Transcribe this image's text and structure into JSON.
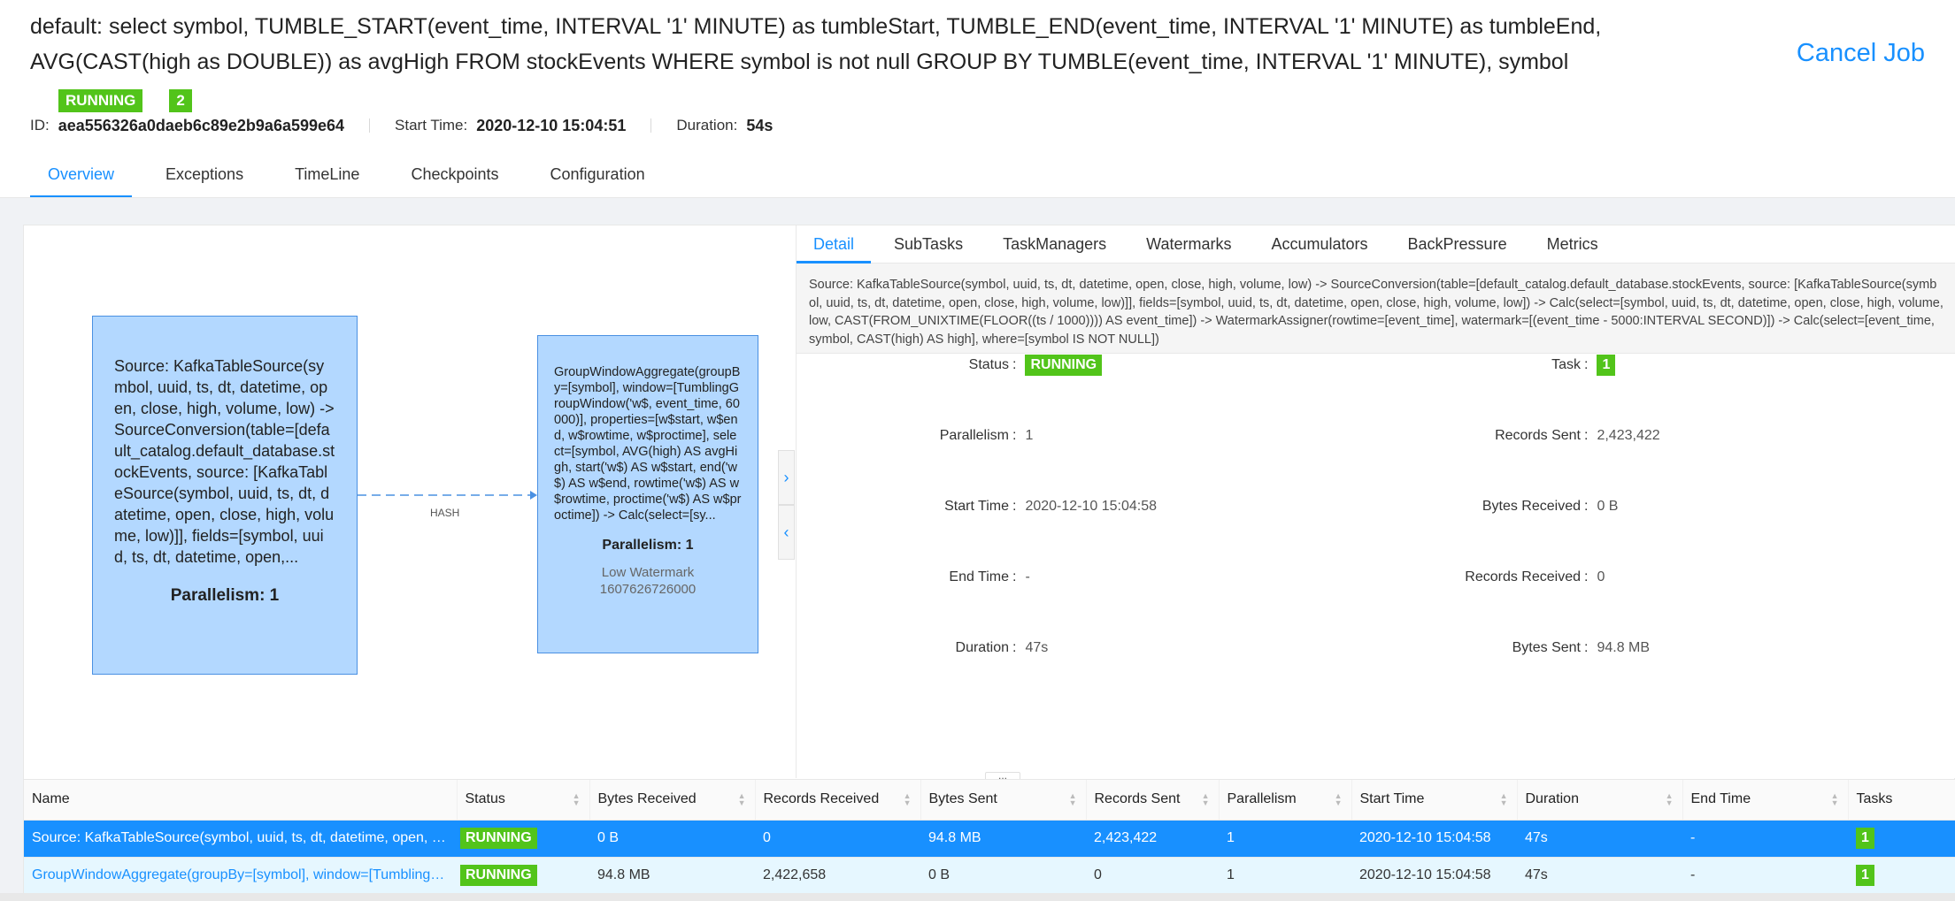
{
  "job": {
    "title": "default: select symbol, TUMBLE_START(event_time, INTERVAL '1' MINUTE) as tumbleStart, TUMBLE_END(event_time, INTERVAL '1' MINUTE) as tumbleEnd, AVG(CAST(high as DOUBLE)) as avgHigh FROM stockEvents WHERE symbol is not null GROUP BY TUMBLE(event_time, INTERVAL '1' MINUTE), symbol",
    "cancel_label": "Cancel Job",
    "status": "RUNNING",
    "running_count": "2",
    "id_label": "ID:",
    "id": "aea556326a0daeb6c89e2b9a6a599e64",
    "start_label": "Start Time:",
    "start_time": "2020-12-10 15:04:51",
    "duration_label": "Duration:",
    "duration": "54s"
  },
  "tabs": [
    "Overview",
    "Exceptions",
    "TimeLine",
    "Checkpoints",
    "Configuration"
  ],
  "graph": {
    "node1": {
      "text": "Source: KafkaTableSource(symbol, uuid, ts, dt, datetime, open, close, high, volume, low) -> SourceConversion(table=[default_catalog.default_database.stockEvents, source: [KafkaTableSource(symbol, uuid, ts, dt, datetime, open, close, high, volume, low)]], fields=[symbol, uuid, ts, dt, datetime, open,...",
      "parallelism": "Parallelism: 1"
    },
    "node2": {
      "text": "GroupWindowAggregate(groupBy=[symbol], window=[TumblingGroupWindow('w$, event_time, 60000)], properties=[w$start, w$end, w$rowtime, w$proctime], select=[symbol, AVG(high) AS avgHigh, start('w$) AS w$start, end('w$) AS w$end, rowtime('w$) AS w$rowtime, proctime('w$) AS w$proctime]) -> Calc(select=[sy...",
      "parallelism": "Parallelism: 1",
      "watermark_label": "Low Watermark",
      "watermark_value": "1607626726000"
    },
    "edge_label": "HASH",
    "colors": {
      "node_fill": "#b3d8ff",
      "node_border": "#4a90e2",
      "edge": "#4a90e2"
    }
  },
  "detail": {
    "tabs": [
      "Detail",
      "SubTasks",
      "TaskManagers",
      "Watermarks",
      "Accumulators",
      "BackPressure",
      "Metrics"
    ],
    "description": "Source: KafkaTableSource(symbol, uuid, ts, dt, datetime, open, close, high, volume, low) -> SourceConversion(table=[default_catalog.default_database.stockEvents, source: [KafkaTableSource(symbol, uuid, ts, dt, datetime, open, close, high, volume, low)]], fields=[symbol, uuid, ts, dt, datetime, open, close, high, volume, low]) -> Calc(select=[symbol, uuid, ts, dt, datetime, open, close, high, volume, low, CAST(FROM_UNIXTIME(FLOOR((ts / 1000)))) AS event_time]) -> WatermarkAssigner(rowtime=[event_time], watermark=[(event_time - 5000:INTERVAL SECOND)]) -> Calc(select=[event_time, symbol, CAST(high) AS high], where=[symbol IS NOT NULL])",
    "left": [
      {
        "label": "Status",
        "value": "RUNNING",
        "badge": true
      },
      {
        "label": "Parallelism",
        "value": "1"
      },
      {
        "label": "Start Time",
        "value": "2020-12-10 15:04:58"
      },
      {
        "label": "End Time",
        "value": "-"
      },
      {
        "label": "Duration",
        "value": "47s"
      }
    ],
    "right": [
      {
        "label": "Task",
        "value": "1",
        "badge": true
      },
      {
        "label": "Records Sent",
        "value": "2,423,422"
      },
      {
        "label": "Bytes Received",
        "value": "0 B"
      },
      {
        "label": "Records Received",
        "value": "0"
      },
      {
        "label": "Bytes Sent",
        "value": "94.8 MB"
      }
    ]
  },
  "table": {
    "columns": [
      "Name",
      "Status",
      "Bytes Received",
      "Records Received",
      "Bytes Sent",
      "Records Sent",
      "Parallelism",
      "Start Time",
      "Duration",
      "End Time",
      "Tasks"
    ],
    "rows": [
      [
        "Source: KafkaTableSource(symbol, uuid, ts, dt, datetime, open, clo...",
        "RUNNING",
        "0 B",
        "0",
        "94.8 MB",
        "2,423,422",
        "1",
        "2020-12-10 15:04:58",
        "47s",
        "-",
        "1"
      ],
      [
        "GroupWindowAggregate(groupBy=[symbol], window=[TumblingGr...",
        "RUNNING",
        "94.8 MB",
        "2,422,658",
        "0 B",
        "0",
        "1",
        "2020-12-10 15:04:58",
        "47s",
        "-",
        "1"
      ]
    ]
  },
  "colors": {
    "accent": "#1890ff",
    "running": "#52c41a",
    "selected_row": "#1890ff",
    "hover_row": "#e6f7ff"
  }
}
